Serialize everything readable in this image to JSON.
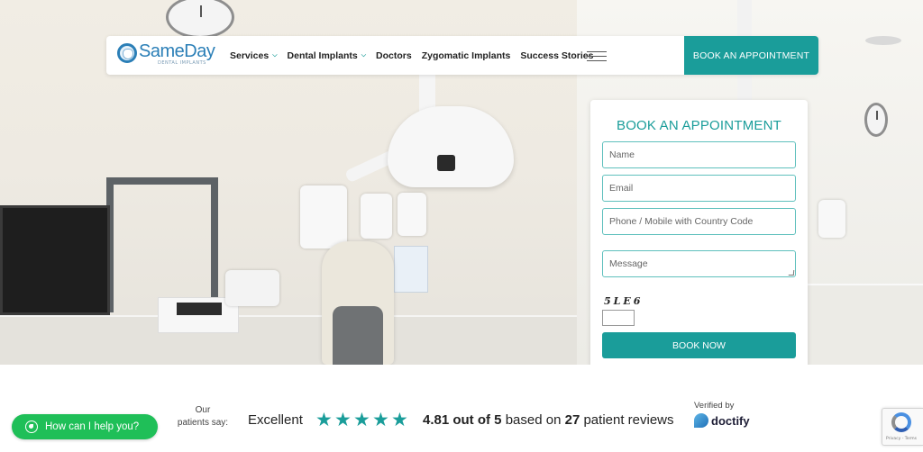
{
  "brand": {
    "name": "SameDay",
    "tagline": "DENTAL IMPLANTS"
  },
  "nav": {
    "items": [
      {
        "label": "Services",
        "has_dropdown": true
      },
      {
        "label": "Dental Implants",
        "has_dropdown": true
      },
      {
        "label": "Doctors",
        "has_dropdown": false
      },
      {
        "label": "Zygomatic Implants",
        "has_dropdown": false
      },
      {
        "label": "Success Stories",
        "has_dropdown": false
      }
    ],
    "menu_icon": "hamburger-icon",
    "cta_label": "BOOK AN APPOINTMENT"
  },
  "form": {
    "title": "BOOK AN APPOINTMENT",
    "name_placeholder": "Name",
    "email_placeholder": "Email",
    "phone_placeholder": "Phone / Mobile with Country Code",
    "message_placeholder": "Message",
    "captcha_code": "5LE6",
    "submit_label": "BOOK NOW"
  },
  "reviews": {
    "intro_line1": "Our",
    "intro_line2": "patients say:",
    "rating_word": "Excellent",
    "stars": 5,
    "score": "4.81 out of 5",
    "based_on": "based on",
    "count": "27",
    "suffix": "patient reviews",
    "verified_label": "Verified by",
    "provider": "doctify"
  },
  "chat": {
    "label": "How can I help you?",
    "icon": "whatsapp-icon"
  },
  "recaptcha": {
    "text": "Privacy - Terms"
  },
  "colors": {
    "accent": "#1a9d9a",
    "whatsapp": "#1fbf58",
    "brand_blue": "#2b7fb7"
  }
}
